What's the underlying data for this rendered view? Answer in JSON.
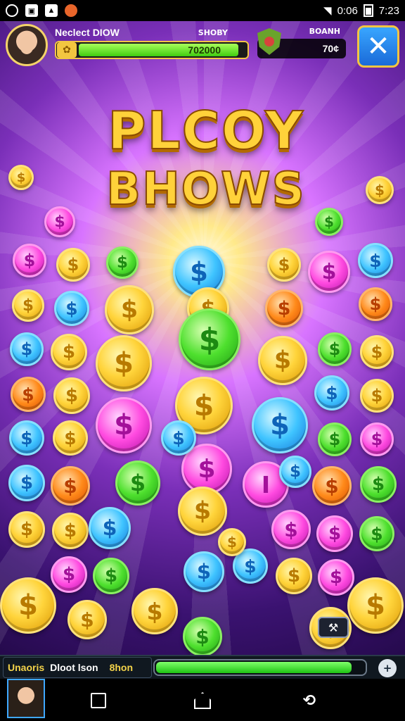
{
  "status_bar": {
    "icons": [
      "notification-icon",
      "gallery-icon",
      "photo-icon",
      "app-icon"
    ],
    "signal": "0:06",
    "time": "7:23"
  },
  "hud": {
    "player_name": "Neclect DIOW",
    "xp_label": "SHOBY",
    "xp_value": "702000",
    "xp_progress": 0.97,
    "coins_label": "BOANH",
    "coins_value": "70¢",
    "close_symbol": "✕"
  },
  "title": {
    "line1": "PLCOY",
    "line2": "BHOWS"
  },
  "coins": {
    "symbol": "$",
    "alt_symbol": "I"
  },
  "bottom_panel": {
    "name": "Unaoris",
    "label": "Dloot lson",
    "value": "8hon",
    "progress": 0.94,
    "pin_symbol": "+"
  },
  "nav": {
    "back_symbol": "⟲"
  },
  "colors": {
    "gold": "#ffd43b",
    "green": "#4ee02e",
    "blue": "#3fc4ff",
    "pink": "#ff4ae0",
    "orange": "#ff8a1a",
    "background": "#7a2fb8"
  }
}
